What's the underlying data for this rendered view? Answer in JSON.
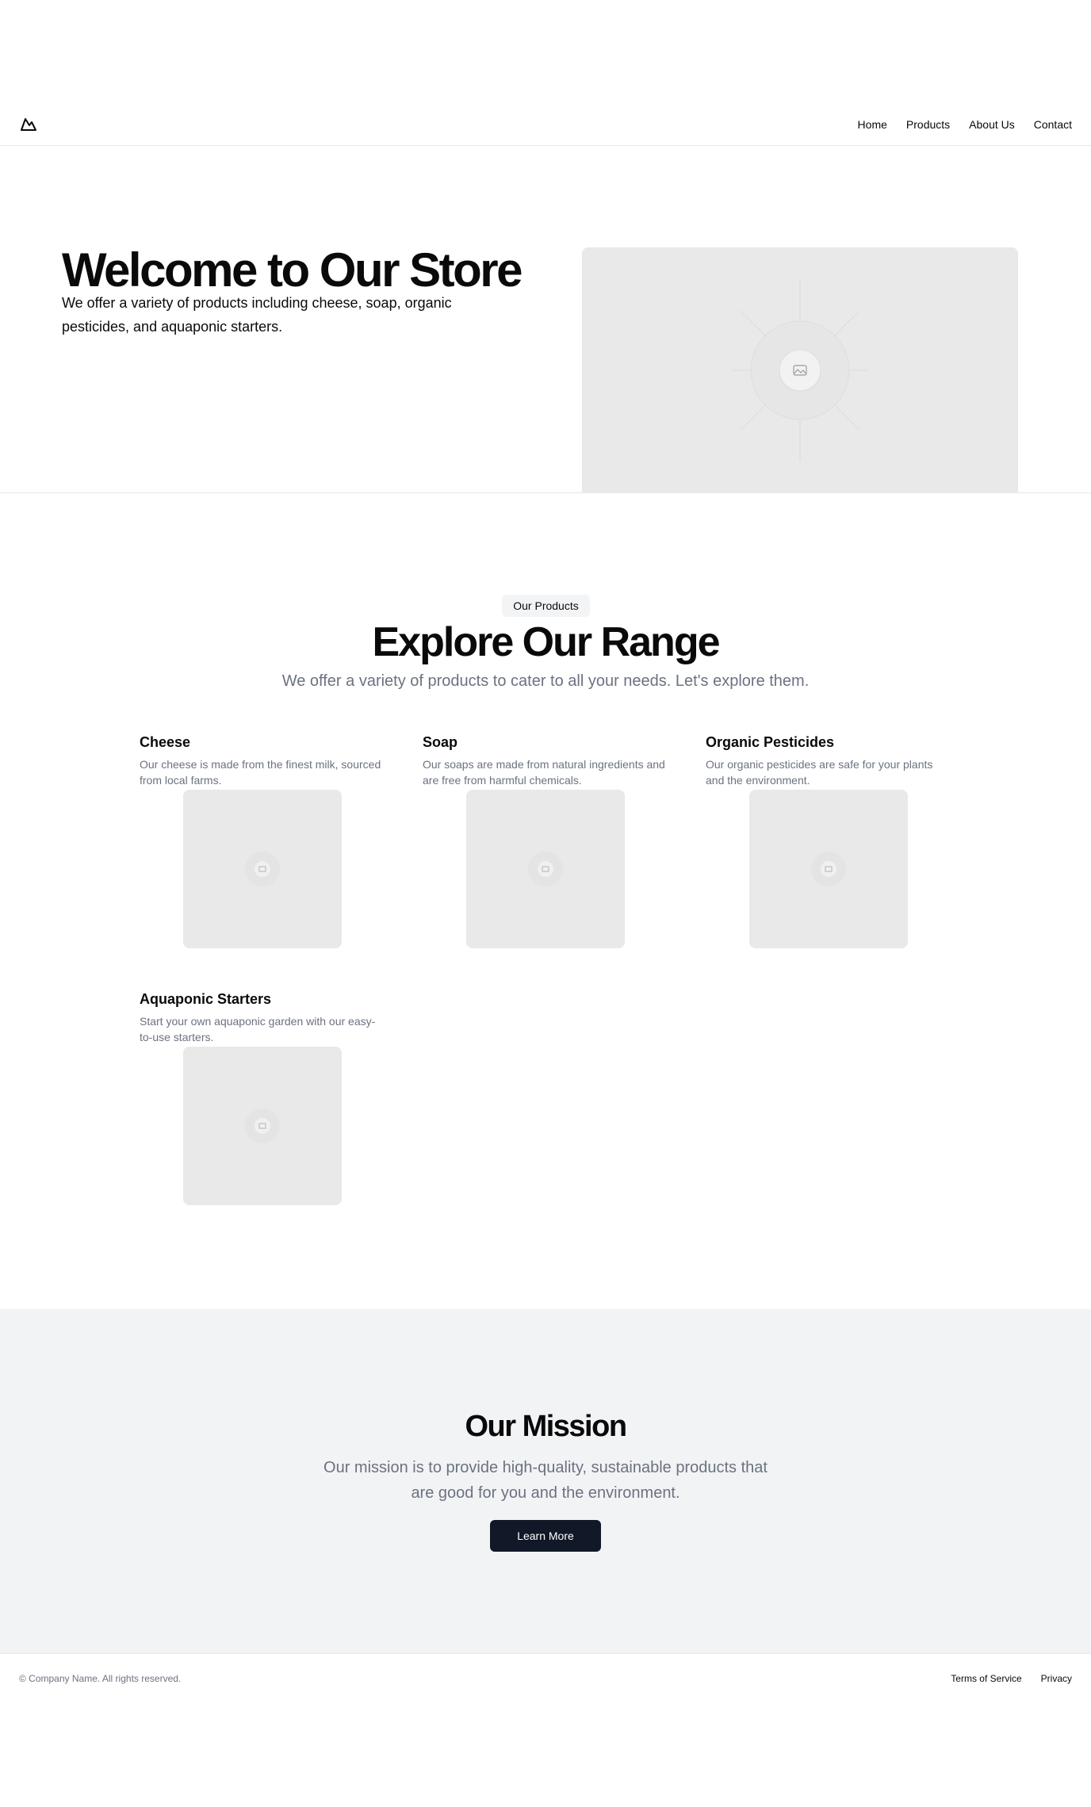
{
  "header": {
    "nav": [
      "Home",
      "Products",
      "About Us",
      "Contact"
    ]
  },
  "hero": {
    "title": "Welcome to Our Store",
    "text": "We offer a variety of products including cheese, soap, organic pesticides, and aquaponic starters."
  },
  "products": {
    "badge": "Our Products",
    "title": "Explore Our Range",
    "subtitle": "We offer a variety of products to cater to all your needs. Let's explore them.",
    "items": [
      {
        "title": "Cheese",
        "desc": "Our cheese is made from the finest milk, sourced from local farms."
      },
      {
        "title": "Soap",
        "desc": "Our soaps are made from natural ingredients and are free from harmful chemicals."
      },
      {
        "title": "Organic Pesticides",
        "desc": "Our organic pesticides are safe for your plants and the environment."
      },
      {
        "title": "Aquaponic Starters",
        "desc": "Start your own aquaponic garden with our easy-to-use starters."
      }
    ]
  },
  "mission": {
    "title": "Our Mission",
    "text": "Our mission is to provide high-quality, sustainable products that are good for you and the environment.",
    "button": "Learn More"
  },
  "footer": {
    "copyright": "© Company Name. All rights reserved.",
    "links": [
      "Terms of Service",
      "Privacy"
    ]
  },
  "colors": {
    "button_bg": "#111827",
    "mission_bg": "#f2f3f5",
    "placeholder_bg": "#e9e9e9",
    "muted_text": "#6b7280"
  },
  "icons": {
    "logo": "mountain-icon",
    "placeholder": "image-placeholder-icon"
  }
}
